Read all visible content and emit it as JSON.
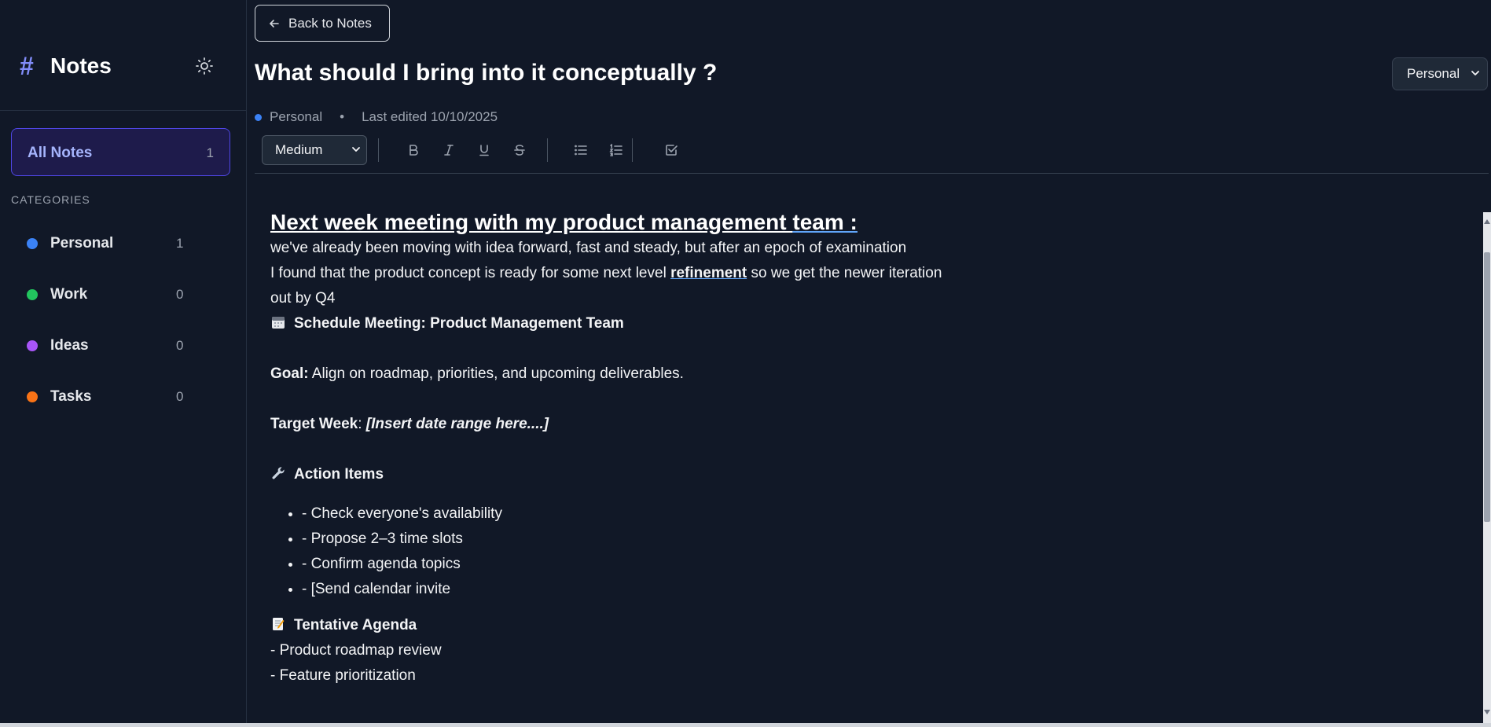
{
  "sidebar": {
    "brand_hash": "#",
    "brand_title": "Notes",
    "theme_icon": "sun-icon",
    "all_notes": {
      "label": "All Notes",
      "count": "1"
    },
    "categories_heading": "CATEGORIES",
    "categories": [
      {
        "name": "Personal",
        "count": "1",
        "color": "#3b82f6"
      },
      {
        "name": "Work",
        "count": "0",
        "color": "#22c55e"
      },
      {
        "name": "Ideas",
        "count": "0",
        "color": "#a855f7"
      },
      {
        "name": "Tasks",
        "count": "0",
        "color": "#f97316"
      }
    ]
  },
  "header": {
    "back_label": "Back to Notes",
    "title": "What should I bring into it conceptually ?",
    "category_select": "Personal",
    "meta_category": "Personal",
    "meta_separator": "•",
    "last_edited": "Last edited 10/10/2025"
  },
  "toolbar": {
    "size_select": "Medium",
    "buttons": [
      "bold-icon",
      "italic-icon",
      "underline-icon",
      "strikethrough-icon",
      "bullet-list-icon",
      "numbered-list-icon",
      "checkbox-icon"
    ]
  },
  "editor": {
    "heading_a": "Next week meeting with my product management ",
    "heading_b": "team :",
    "line1": "we've already been moving with idea forward, fast and steady, but after an epoch of examination",
    "line2_a": "I found that the product concept is ready for some next level ",
    "line2_link": "refinement",
    "line2_b": " so we get the newer iteration",
    "line3": "out by Q4",
    "schedule": "Schedule Meeting: Product Management Team",
    "goal_label": "Goal:",
    "goal_text": " Align on roadmap, priorities, and upcoming deliverables.",
    "target_label": "Target Week",
    "target_colon": ": ",
    "target_value": "[Insert date range here....]",
    "action_heading": "Action Items",
    "actions": [
      "- Check everyone's availability",
      "- Propose 2–3 time slots",
      "- Confirm agenda topics",
      "- [Send calendar invite"
    ],
    "agenda_heading": "Tentative Agenda",
    "agenda": [
      "- Product roadmap review",
      "- Feature prioritization"
    ]
  },
  "colors": {
    "background": "#111827",
    "accent": "#818cf8",
    "active_bg": "#1e1b4b",
    "active_border": "#4f46e5"
  }
}
